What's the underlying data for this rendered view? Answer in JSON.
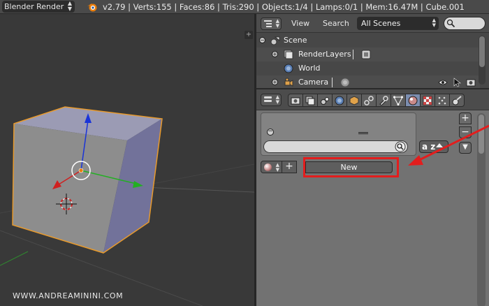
{
  "topbar": {
    "render_engine": "Blender Render",
    "stats": "v2.79 | Verts:155 | Faces:86 | Tris:290 | Objects:1/4 | Lamps:0/1 | Mem:16.47M | Cube.001"
  },
  "viewport": {
    "watermark": "WWW.ANDREAMININI.COM",
    "plus_label": "+"
  },
  "outliner": {
    "menu_view": "View",
    "menu_search": "Search",
    "display_mode": "All Scenes",
    "tree": [
      {
        "label": "Scene",
        "expander": "−"
      },
      {
        "label": "RenderLayers",
        "expander": "+"
      },
      {
        "label": "World",
        "expander": ""
      },
      {
        "label": "Camera",
        "expander": "+"
      }
    ]
  },
  "properties": {
    "tabs": [
      "render-icon",
      "render-layers-icon",
      "scene-icon",
      "world-icon",
      "object-icon",
      "constraints-icon",
      "modifiers-icon",
      "data-icon",
      "material-icon",
      "texture-icon",
      "particles-icon",
      "physics-icon"
    ],
    "active_tab": "material-icon",
    "slot_panel": {
      "minus_label": "−",
      "sort_label": "a z"
    },
    "side_buttons": {
      "add": "+",
      "remove": "−",
      "specials": "▼"
    },
    "material": {
      "plus_label": "+",
      "new_button": "New"
    }
  },
  "colors": {
    "highlight": "#e31d1d",
    "selection_outline": "#e89a2c",
    "axis_x": "#d02020",
    "axis_y": "#22b022",
    "axis_z": "#1a34d8",
    "active_tab": "#7c8eb0"
  }
}
